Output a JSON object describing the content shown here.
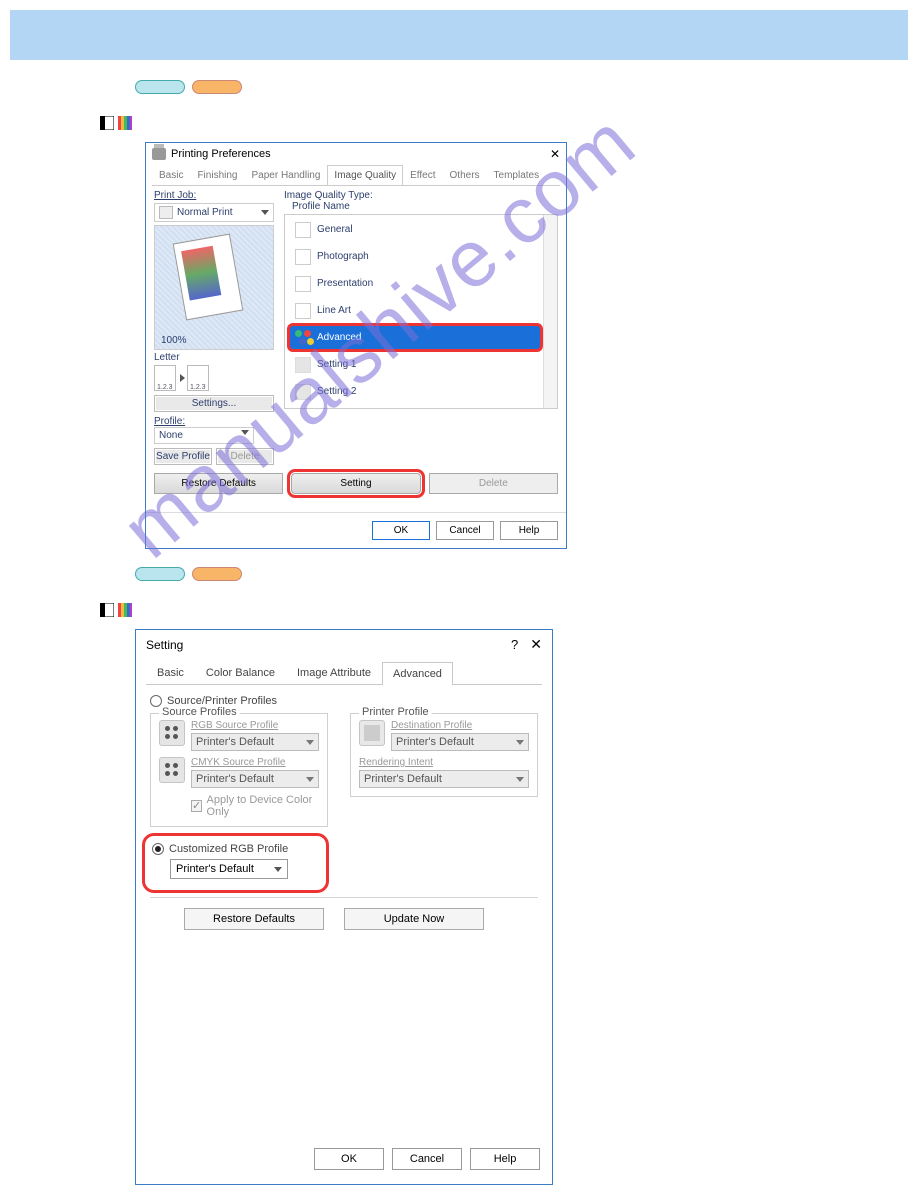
{
  "watermark_text": "manualshive.com",
  "dialog1": {
    "title": "Printing Preferences",
    "tabs": [
      "Basic",
      "Finishing",
      "Paper Handling",
      "Image Quality",
      "Effect",
      "Others",
      "Templates"
    ],
    "active_tab_index": 3,
    "print_job_label": "Print Job:",
    "print_job_value": "Normal Print",
    "zoom": "100%",
    "paper_size_label": "Letter",
    "sheet1": "1.2.3",
    "sheet2": "1.2.3",
    "settings_btn": "Settings...",
    "profile_label": "Profile:",
    "profile_value": "None",
    "save_profile_btn": "Save Profile",
    "delete_profile_btn": "Delete",
    "image_quality_type_label": "Image Quality Type:",
    "profile_name_label": "Profile Name",
    "profiles": [
      "General",
      "Photograph",
      "Presentation",
      "Line Art",
      "Advanced",
      "Setting 1",
      "Setting 2"
    ],
    "selected_profile_index": 4,
    "restore_defaults_btn": "Restore Defaults",
    "setting_btn": "Setting",
    "delete_btn": "Delete",
    "ok_btn": "OK",
    "cancel_btn": "Cancel",
    "help_btn": "Help"
  },
  "dialog2": {
    "title": "Setting",
    "tabs": [
      "Basic",
      "Color Balance",
      "Image Attribute",
      "Advanced"
    ],
    "active_tab_index": 3,
    "source_printer_radio": "Source/Printer Profiles",
    "source_profiles_legend": "Source Profiles",
    "printer_profile_legend": "Printer Profile",
    "rgb_source_label": "RGB Source Profile",
    "cmyk_source_label": "CMYK Source Profile",
    "destination_label": "Destination Profile",
    "rendering_label": "Rendering Intent",
    "printers_default": "Printer's Default",
    "apply_device_label": "Apply to Device Color Only",
    "customized_rgb_radio": "Customized RGB Profile",
    "restore_defaults_btn": "Restore Defaults",
    "update_now_btn": "Update Now",
    "ok_btn": "OK",
    "cancel_btn": "Cancel",
    "help_btn": "Help"
  }
}
